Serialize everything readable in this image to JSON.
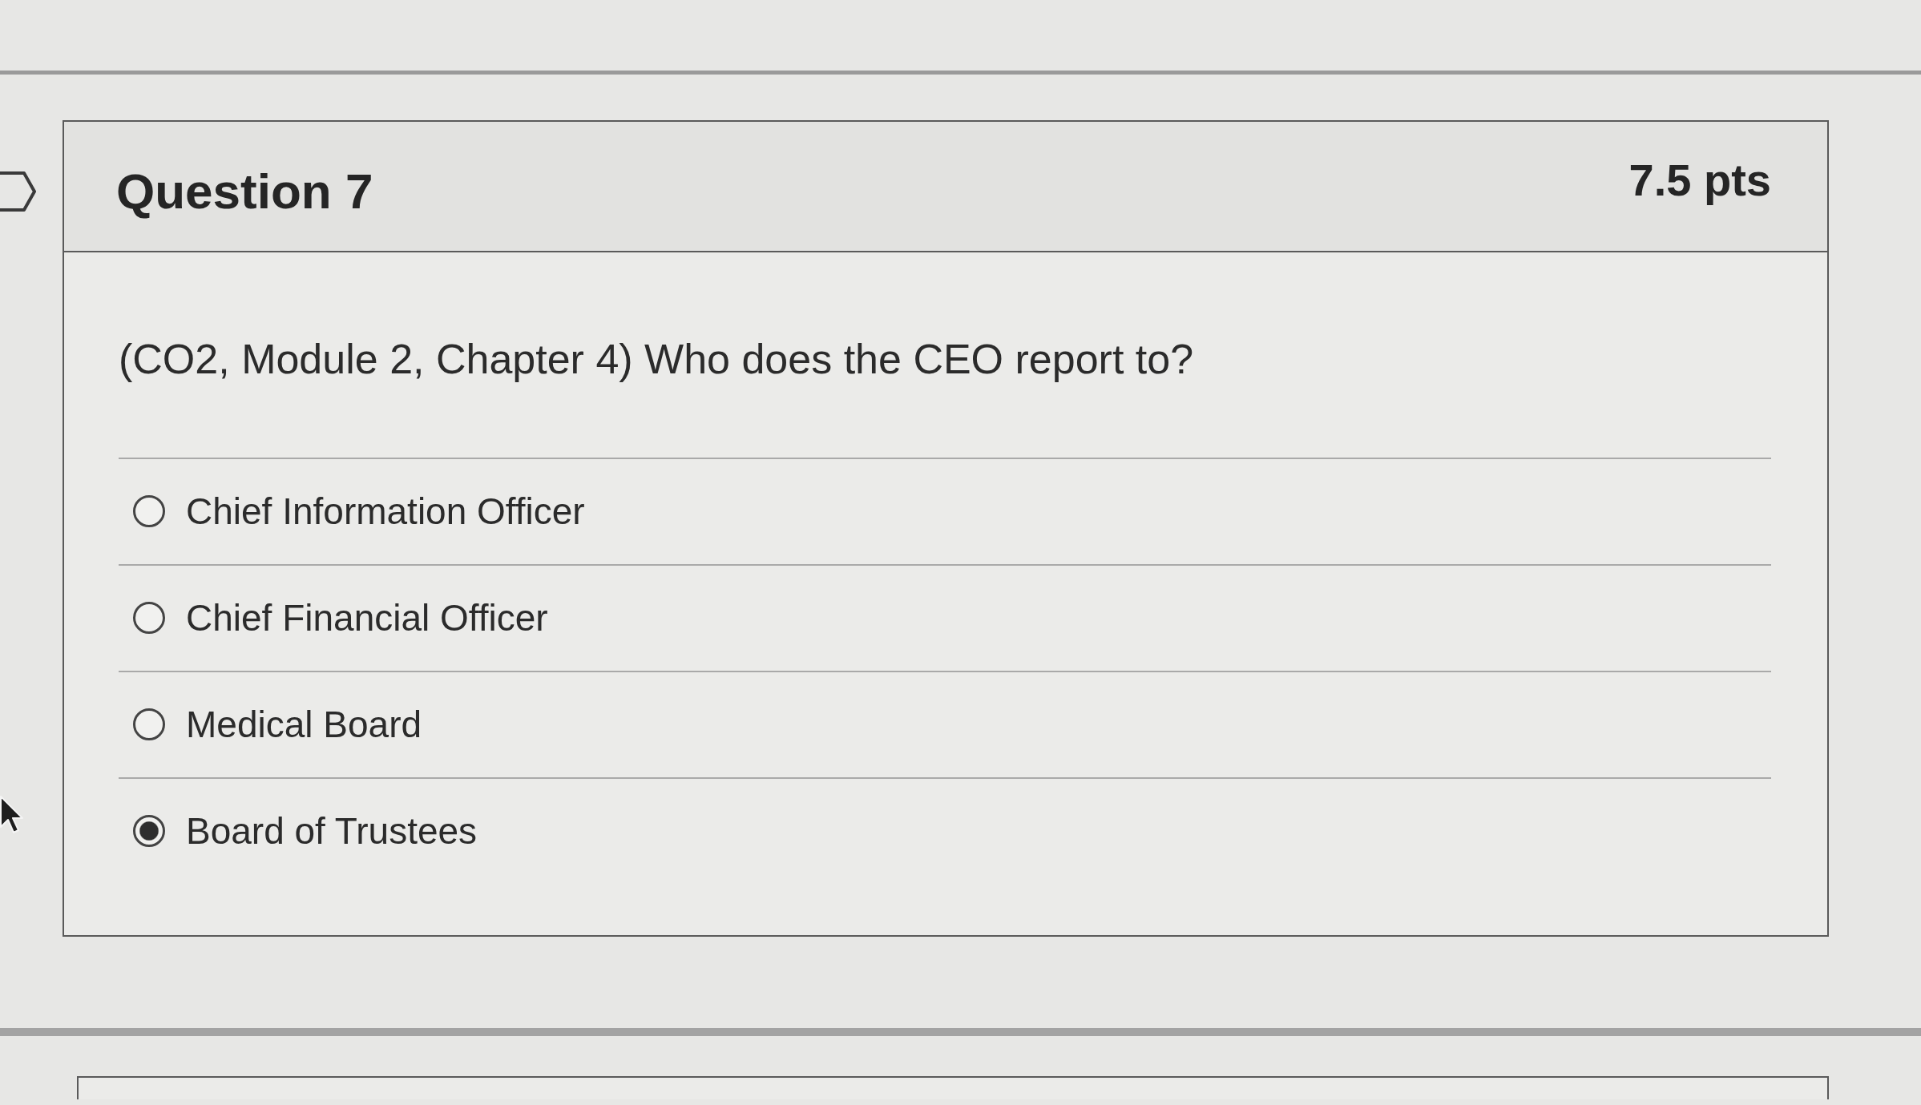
{
  "question": {
    "title": "Question 7",
    "points": "7.5 pts",
    "text": "(CO2, Module 2, Chapter 4) Who does the CEO report to?",
    "answers": [
      {
        "label": "Chief Information Officer",
        "selected": false
      },
      {
        "label": "Chief Financial Officer",
        "selected": false
      },
      {
        "label": "Medical Board",
        "selected": false
      },
      {
        "label": "Board of Trustees",
        "selected": true
      }
    ]
  }
}
